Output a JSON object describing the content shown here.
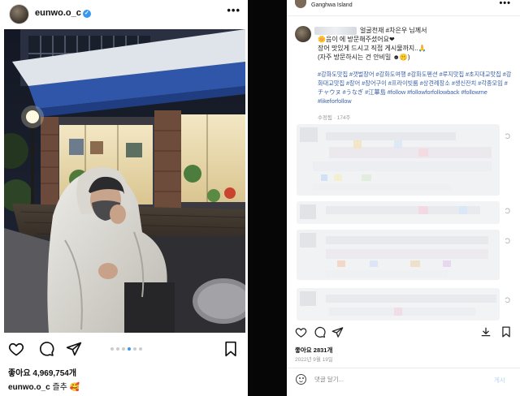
{
  "left_post": {
    "username": "eunwo.o_c",
    "verified_mark": "✓",
    "more_label": "•••",
    "icons": [
      "heart-icon",
      "comment-icon",
      "share-icon",
      "bookmark-icon"
    ],
    "carousel": {
      "count": 6,
      "active_index": 3
    },
    "likes": "좋아요 4,969,754개",
    "caption_user": "eunwo.o_c",
    "caption_text": "즐추 🥰"
  },
  "right_post": {
    "location": "Ganghwa Island",
    "more_label": "•••",
    "text_line1": "얼굴천재 #차은우 님께서",
    "text_line2": "🌼음이 에 방문해주셨어요❤",
    "text_line3": "장어 맛있게 드시고 직접 게시물까지..🙏",
    "text_line4": "(자주 방문하시는 건 안비밀 ☻🤫)",
    "hashtags": "#강화도맛집 #갯벌장어 #강화도여행 #강화도펜션 #루지맛집 #초지대교맛집 #강화대교맛집 #장어 #장어구이 #프라이빗룸 #상견례장소 #생신잔치 #각종모임 #チャウヌ #うなぎ #江華島 #follow #followforfollowback #followme #likeforfollow",
    "edited": "수정됨 · 174주",
    "reply_icon": "Ɔ",
    "likes": "좋아요 2831개",
    "date": "2022년 9월 19일",
    "comment_placeholder": "댓글 달기...",
    "post_label": "게시",
    "icons": [
      "heart-icon",
      "comment-icon",
      "share-icon",
      "download-icon",
      "bookmark-icon"
    ]
  },
  "colors": {
    "verified": "#3897f0",
    "hashtag": "#3a5fa8",
    "divider": "#060606",
    "heart": "#e0245e"
  }
}
